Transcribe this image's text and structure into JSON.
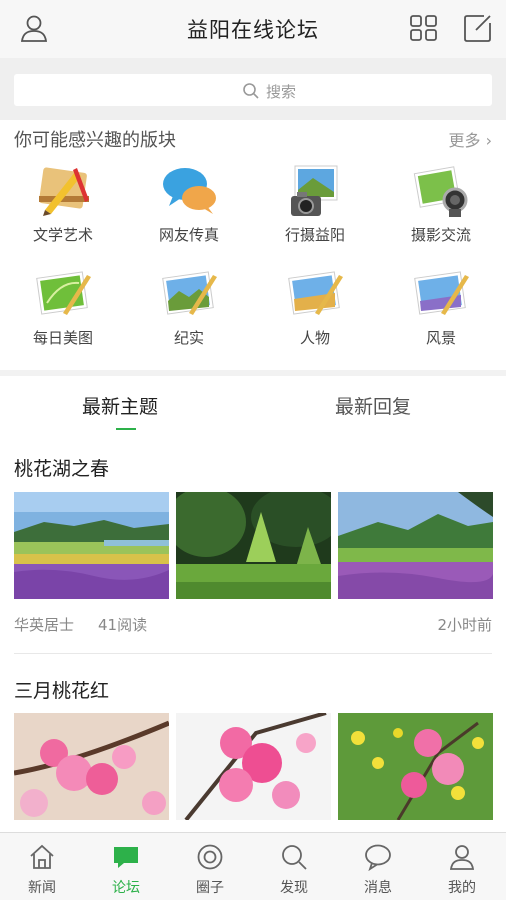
{
  "header": {
    "title": "益阳在线论坛"
  },
  "search": {
    "placeholder": "搜索"
  },
  "interest": {
    "heading": "你可能感兴趣的版块",
    "more": "更多",
    "items": [
      {
        "label": "文学艺术",
        "icon": "pencil-ruler-icon"
      },
      {
        "label": "网友传真",
        "icon": "chat-bubbles-icon"
      },
      {
        "label": "行摄益阳",
        "icon": "camera-photo-icon"
      },
      {
        "label": "摄影交流",
        "icon": "lens-photo-icon"
      },
      {
        "label": "每日美图",
        "icon": "leaf-picture-icon"
      },
      {
        "label": "纪实",
        "icon": "landscape-picture-icon"
      },
      {
        "label": "人物",
        "icon": "landscape-picture-icon"
      },
      {
        "label": "风景",
        "icon": "landscape-picture-icon"
      }
    ]
  },
  "tabs": [
    {
      "label": "最新主题",
      "active": true
    },
    {
      "label": "最新回复",
      "active": false
    }
  ],
  "posts": [
    {
      "title": "桃花湖之春",
      "author": "华英居士",
      "reads": "41阅读",
      "time": "2小时前"
    },
    {
      "title": "三月桃花红"
    }
  ],
  "bottom_nav": [
    {
      "label": "新闻",
      "icon": "house-icon"
    },
    {
      "label": "论坛",
      "icon": "forum-bubble-icon",
      "active": true
    },
    {
      "label": "圈子",
      "icon": "circle-icon"
    },
    {
      "label": "发现",
      "icon": "search-icon"
    },
    {
      "label": "消息",
      "icon": "message-icon"
    },
    {
      "label": "我的",
      "icon": "user-icon"
    }
  ],
  "colors": {
    "accent": "#2db14a",
    "background": "#f2f2f2"
  }
}
